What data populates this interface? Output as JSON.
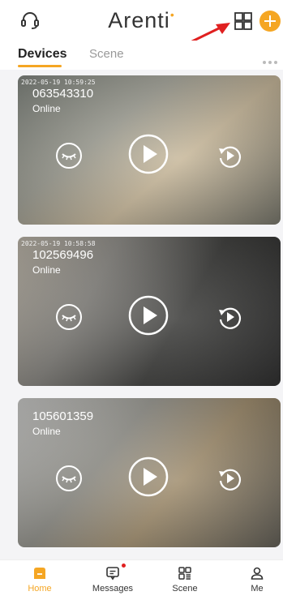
{
  "header": {
    "logo": "Arenti",
    "logo_dot": "•",
    "icons": [
      "headset-icon",
      "grid-view-icon",
      "add-icon"
    ],
    "accent_color": "#f5a623"
  },
  "tabs": {
    "devices": "Devices",
    "scene": "Scene"
  },
  "devices": [
    {
      "stamp": "2022-05-19 10:59:25",
      "id": "063543310",
      "status": "Online"
    },
    {
      "stamp": "2022-05-19 10:58:58",
      "id": "102569496",
      "status": "Online"
    },
    {
      "stamp": "",
      "id": "105601359",
      "status": "Online"
    }
  ],
  "tabbar": {
    "home": "Home",
    "messages": "Messages",
    "scene": "Scene",
    "me": "Me"
  }
}
